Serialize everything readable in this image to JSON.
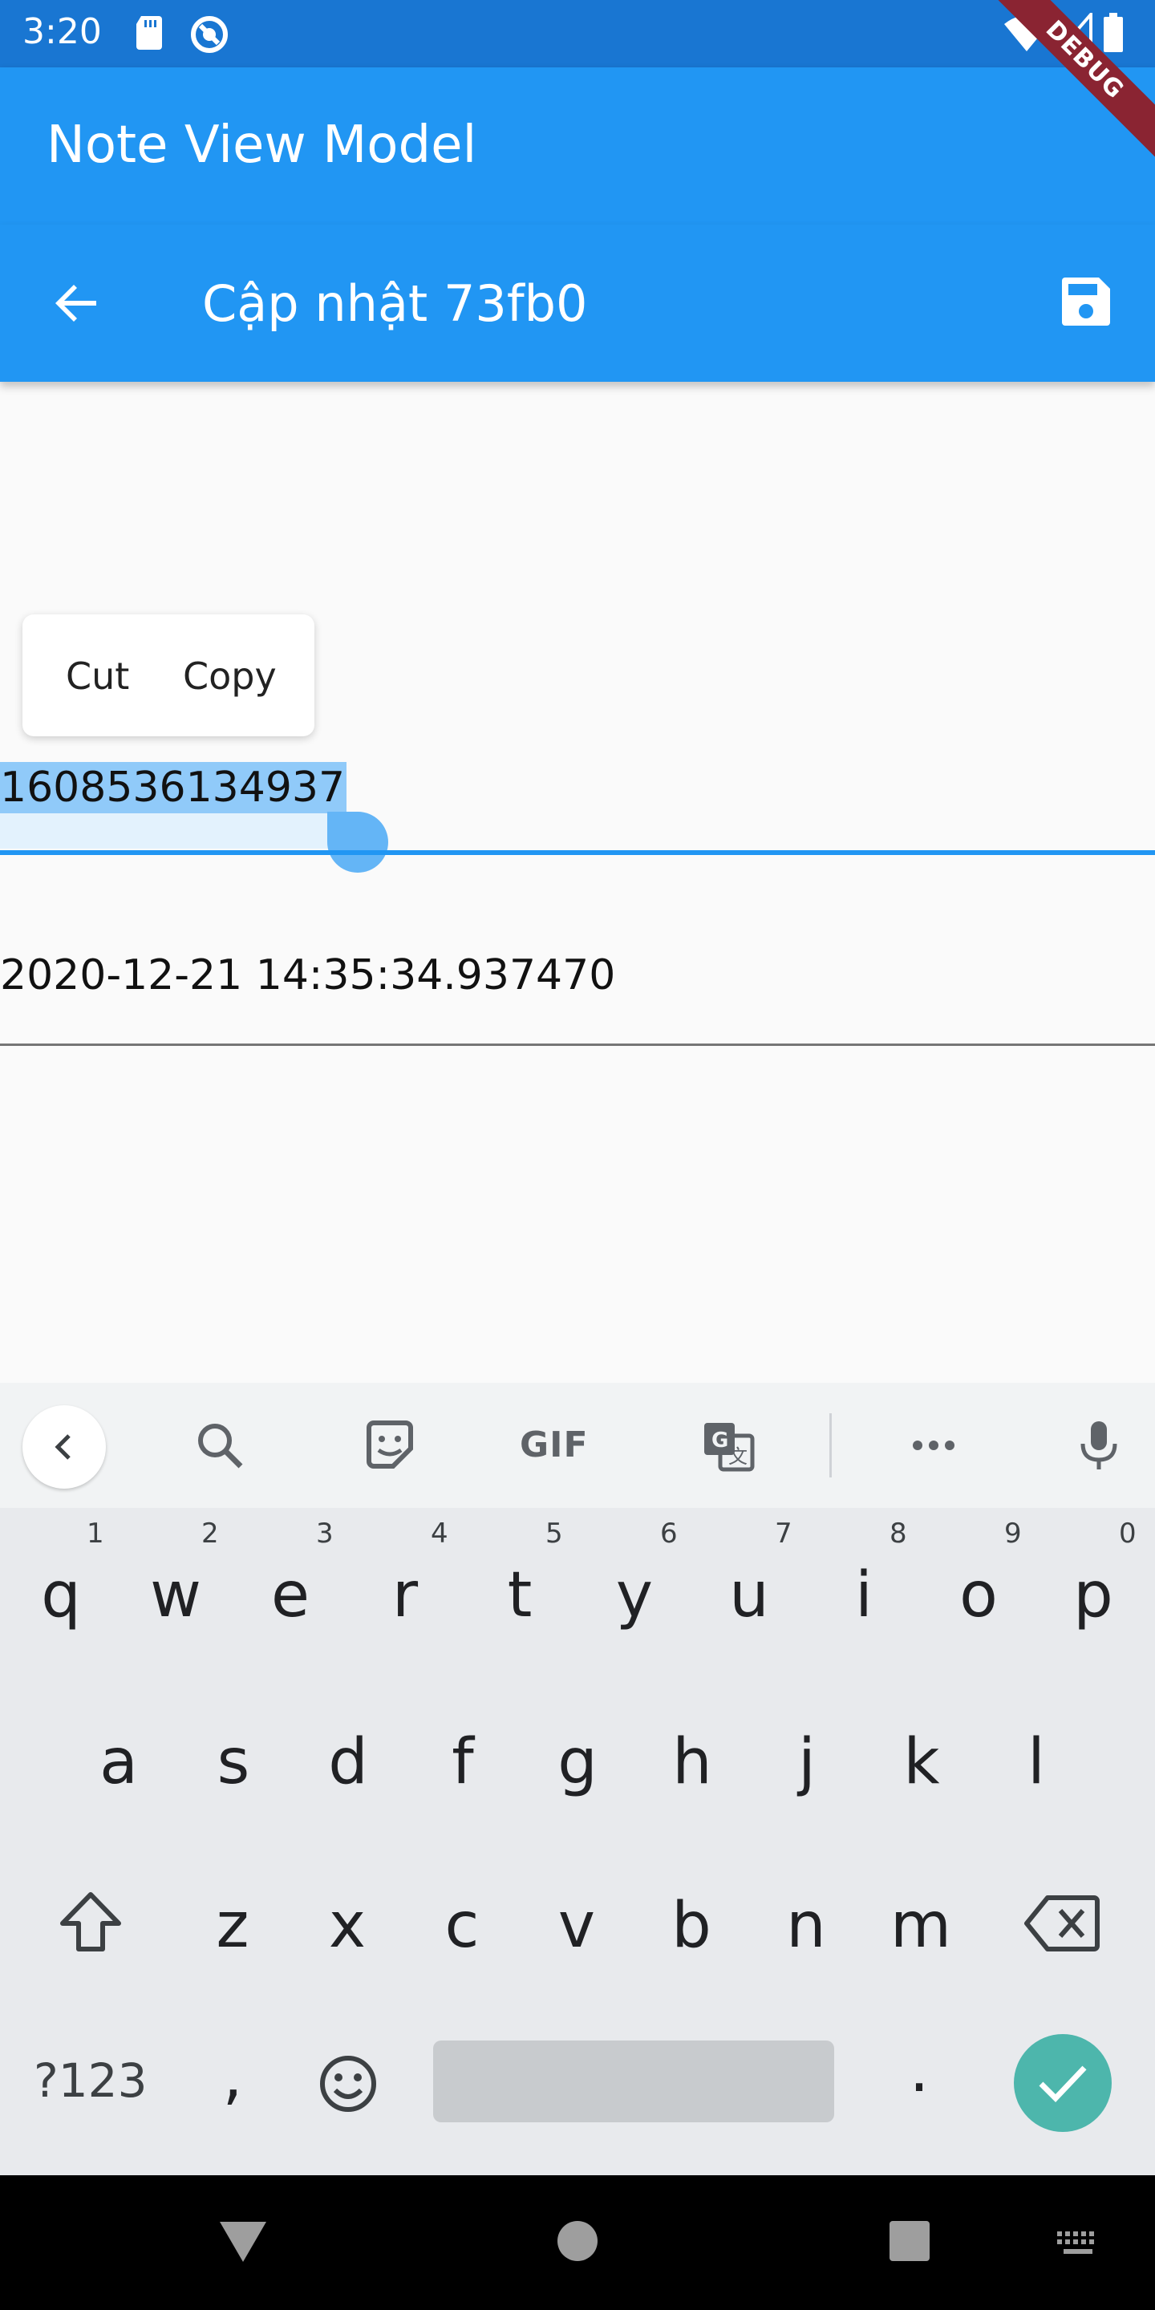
{
  "status_bar": {
    "time": "3:20",
    "icons": [
      "sd-card-icon",
      "q-sync-icon",
      "wifi-icon",
      "signal-icon",
      "battery-icon"
    ]
  },
  "debug_banner": "DEBUG",
  "app_bar": {
    "title": "Note View Model"
  },
  "sub_bar": {
    "title": "Cập nhật 73fb0",
    "back_icon": "arrow-back-icon",
    "save_icon": "save-icon"
  },
  "selection_toolbar": {
    "cut": "Cut",
    "copy": "Copy"
  },
  "fields": {
    "id_value": "1608536134937",
    "date_value": "2020-12-21 14:35:34.937470"
  },
  "keyboard": {
    "toolbar_icons": [
      "chevron-left-icon",
      "search-icon",
      "sticker-icon",
      "gif-icon",
      "translate-icon",
      "more-icon",
      "mic-icon"
    ],
    "gif_label": "GIF",
    "row1": [
      "q",
      "w",
      "e",
      "r",
      "t",
      "y",
      "u",
      "i",
      "o",
      "p"
    ],
    "row1_hints": [
      "1",
      "2",
      "3",
      "4",
      "5",
      "6",
      "7",
      "8",
      "9",
      "0"
    ],
    "row2": [
      "a",
      "s",
      "d",
      "f",
      "g",
      "h",
      "j",
      "k",
      "l"
    ],
    "row3": [
      "z",
      "x",
      "c",
      "v",
      "b",
      "n",
      "m"
    ],
    "symbols_key": "?123",
    "comma": ",",
    "period": "."
  },
  "colors": {
    "status_bar": "#1976d2",
    "app_bar": "#2196f3",
    "selection": "#90caf9",
    "enter_key": "#4db6ac"
  }
}
